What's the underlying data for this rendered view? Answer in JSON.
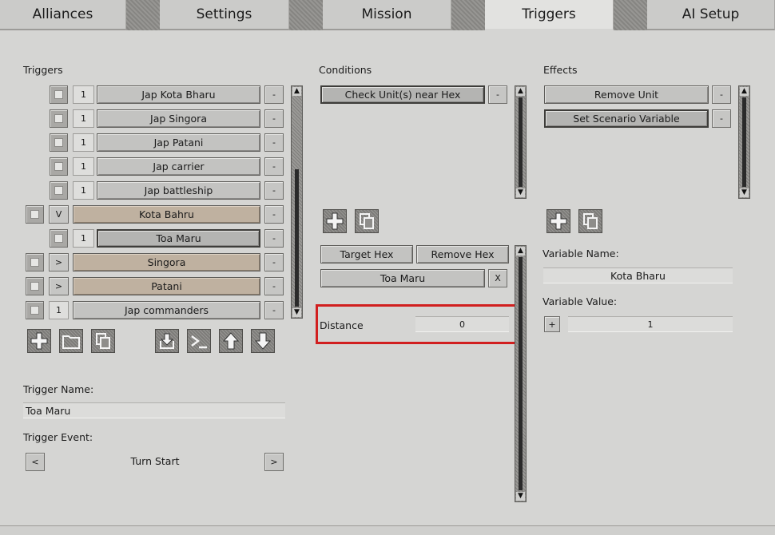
{
  "tabs": [
    {
      "label": "Alliances"
    },
    {
      "label": "Settings"
    },
    {
      "label": "Mission"
    },
    {
      "label": "Triggers"
    },
    {
      "label": "AI Setup"
    }
  ],
  "triggers": {
    "heading": "Triggers",
    "rows": [
      {
        "toggle": "1",
        "label": "Jap Kota Bharu",
        "remove": "-"
      },
      {
        "toggle": "1",
        "label": "Jap Singora",
        "remove": "-"
      },
      {
        "toggle": "1",
        "label": "Jap Patani",
        "remove": "-"
      },
      {
        "toggle": "1",
        "label": "Jap carrier",
        "remove": "-"
      },
      {
        "toggle": "1",
        "label": "Jap battleship",
        "remove": "-"
      },
      {
        "toggle": "V",
        "label": "Kota Bahru",
        "remove": "-"
      },
      {
        "toggle": "1",
        "label": "Toa Maru",
        "remove": "-"
      },
      {
        "toggle": ">",
        "label": "Singora",
        "remove": "-"
      },
      {
        "toggle": ">",
        "label": "Patani",
        "remove": "-"
      },
      {
        "toggle": "1",
        "label": "Jap commanders",
        "remove": "-"
      }
    ],
    "name_label": "Trigger Name:",
    "name_value": "Toa Maru",
    "event_label": "Trigger Event:",
    "event_value": "Turn Start",
    "event_prev": "<",
    "event_next": ">"
  },
  "conditions": {
    "heading": "Conditions",
    "items": [
      {
        "label": "Check Unit(s) near Hex",
        "remove": "-"
      }
    ],
    "target_hex": "Target Hex",
    "remove_hex": "Remove Hex",
    "unit": "Toa Maru",
    "unit_clear": "X",
    "distance_label": "Distance",
    "distance_value": "0"
  },
  "effects": {
    "heading": "Effects",
    "items": [
      {
        "label": "Remove Unit",
        "remove": "-"
      },
      {
        "label": "Set Scenario Variable",
        "remove": "-"
      }
    ],
    "var_name_label": "Variable Name:",
    "var_name_value": "Kota Bharu",
    "var_value_label": "Variable Value:",
    "var_value_op": "+",
    "var_value": "1"
  },
  "colors": {
    "highlight": "#d11f1f",
    "tan_button": "#bfb1a0",
    "gray_button": "#c3c3c1"
  },
  "icons": [
    "add-icon",
    "folder-icon",
    "copy-icon",
    "import-icon",
    "console-icon",
    "arrow-up-icon",
    "arrow-down-icon"
  ]
}
